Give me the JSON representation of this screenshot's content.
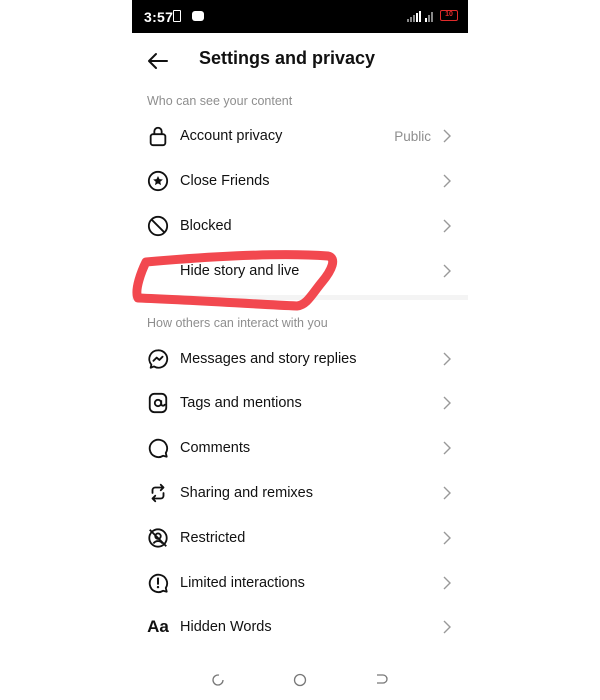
{
  "status_bar": {
    "time": "3:57",
    "battery": "10"
  },
  "header": {
    "title": "Settings and privacy"
  },
  "sections": [
    {
      "label": "Who can see your content",
      "items": [
        {
          "label": "Account privacy",
          "value": "Public",
          "icon": "lock-icon"
        },
        {
          "label": "Close Friends",
          "value": "",
          "icon": "star-circle-icon"
        },
        {
          "label": "Blocked",
          "value": "",
          "icon": "blocked-icon"
        },
        {
          "label": "Hide story and live",
          "value": "",
          "icon": "hide-story-icon"
        }
      ]
    },
    {
      "label": "How others can interact with you",
      "items": [
        {
          "label": "Messages and story replies",
          "icon": "messenger-icon"
        },
        {
          "label": "Tags and mentions",
          "icon": "at-sign-icon"
        },
        {
          "label": "Comments",
          "icon": "comment-icon"
        },
        {
          "label": "Sharing and remixes",
          "icon": "repost-icon"
        },
        {
          "label": "Restricted",
          "icon": "restricted-icon"
        },
        {
          "label": "Limited interactions",
          "icon": "limited-interactions-icon"
        },
        {
          "label": "Hidden Words",
          "icon": "hidden-words-icon"
        }
      ]
    }
  ],
  "annotation": {
    "color": "#f2484f",
    "target": "Hide story and live"
  },
  "colors": {
    "secondary_text": "#8e8e8e",
    "primary_text": "#111111",
    "battery_low": "#e02b2b"
  }
}
